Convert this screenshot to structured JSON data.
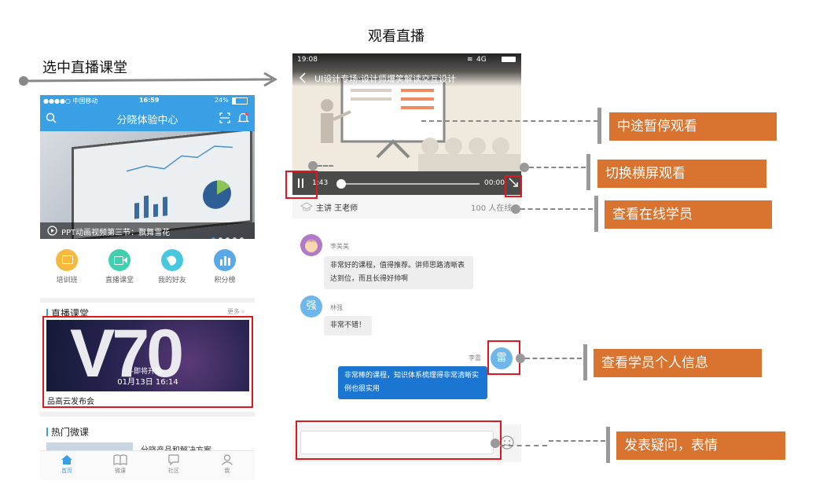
{
  "captions": {
    "select_live": "选中直播课堂",
    "watch_live": "观看直播"
  },
  "left_phone": {
    "status": {
      "carrier": "●●●●○ 中国移动",
      "time": "16:59",
      "battery": "24%"
    },
    "title": "分晓体验中心",
    "banner_caption": "PPT动画视频第三节：飘舞雪花",
    "categories": [
      {
        "label": "培训班",
        "color": "#f6b93b"
      },
      {
        "label": "直播课堂",
        "color": "#40d0b0"
      },
      {
        "label": "我的好友",
        "color": "#48c8e0"
      },
      {
        "label": "积分榜",
        "color": "#59a8e8"
      }
    ],
    "live_section": {
      "title": "直播课堂",
      "more": "更多",
      "poster_big": "V70",
      "poster_sub": "-即将开始-",
      "poster_time": "01月13日 16:14",
      "course_name": "品高云发布会"
    },
    "hot_section": {
      "title": "热门微课",
      "first_item": "分晓产品和解决方案"
    },
    "tabs": [
      "首页",
      "微课",
      "社区",
      "我"
    ]
  },
  "middle_phone": {
    "status": {
      "time": "19:08",
      "network": "4G"
    },
    "video_title": "UI设计专场:设计师爆笑解读交互设计",
    "elapsed": "1:43",
    "duration": "00:00",
    "progress": 0.02,
    "lecturer": "主讲 王老师",
    "online_count": "100 人在线",
    "messages": [
      {
        "user": "李美美",
        "text": "非常好的课程，值得推荐。讲师思路清晰表达到位，而且长得好帅啊"
      },
      {
        "user": "林强",
        "avatar_char": "强",
        "text": "非常不错！"
      },
      {
        "user": "李雷",
        "avatar_char": "雷",
        "text": "非常棒的课程，知识体系梳理得非常清晰实例也很实用"
      }
    ]
  },
  "annotations": [
    "中途暂停观看",
    "切换横屏观看",
    "查看在线学员",
    "查看学员个人信息",
    "发表疑问，表情"
  ],
  "colors": {
    "accent_blue": "#3aa0e6",
    "annotation_orange": "#d87330",
    "highlight_red": "#e0181d"
  }
}
